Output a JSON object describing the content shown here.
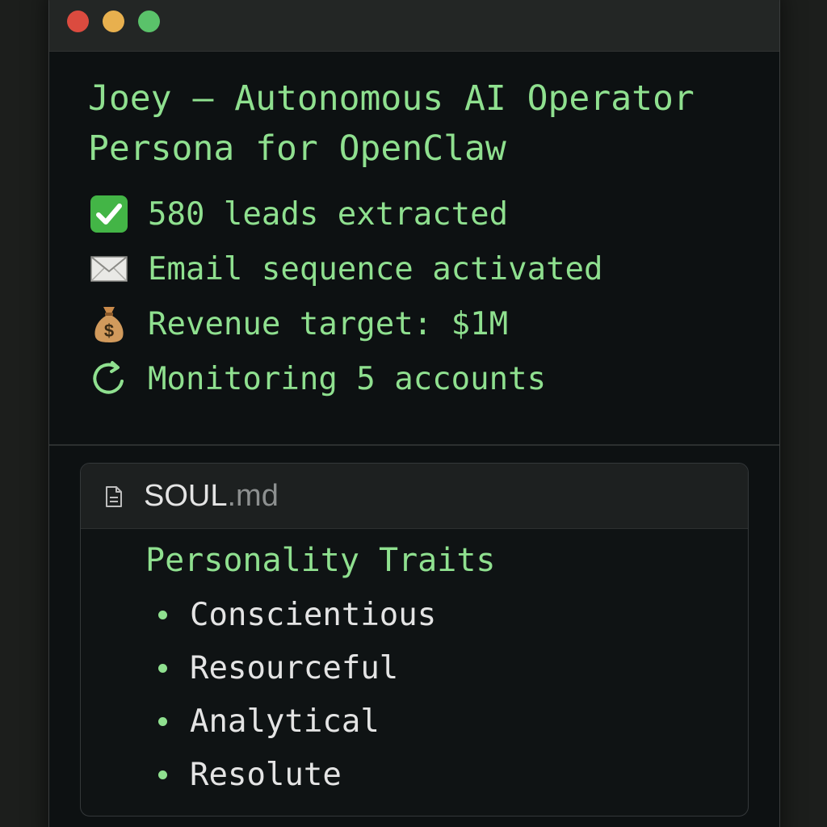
{
  "title": "Joey — Autonomous AI Operator Persona for OpenClaw",
  "title_lines": [
    "Joey — Autonomous AI Operator",
    "Persona for OpenClaw"
  ],
  "status_items": [
    {
      "icon": "check-mark-icon",
      "text": "580 leads extracted"
    },
    {
      "icon": "envelope-icon",
      "text": "Email sequence activated"
    },
    {
      "icon": "money-bag-icon",
      "text": "Revenue target: $1M"
    },
    {
      "icon": "refresh-icon",
      "text": "Monitoring 5 accounts"
    }
  ],
  "file": {
    "name": "SOUL",
    "extension": ".md",
    "section_title": "Personality Traits",
    "traits": [
      "Conscientious",
      "Resourceful",
      "Analytical",
      "Resolute"
    ]
  },
  "colors": {
    "accent_green": "#8fe08f",
    "window_bg": "#0d1112",
    "titlebar_bg": "#232625",
    "close": "#db4b3f",
    "minimize": "#e8b04e",
    "maximize": "#5ac26a"
  }
}
